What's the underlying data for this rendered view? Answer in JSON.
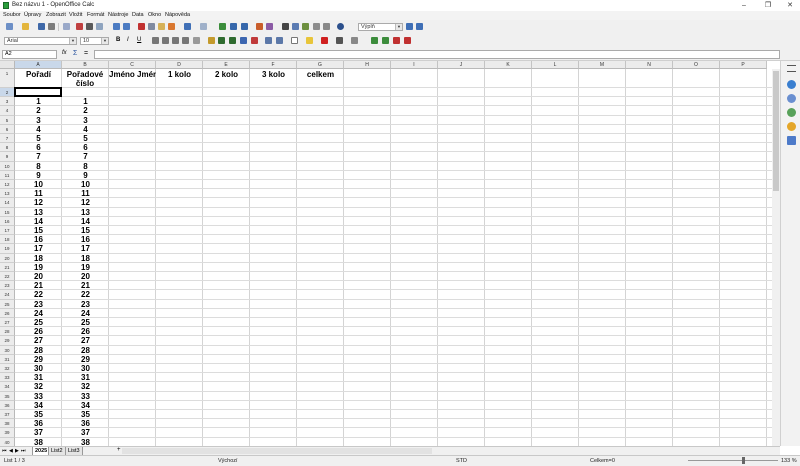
{
  "window": {
    "title": "Bez názvu 1 - OpenOffice Calc",
    "minimize": "–",
    "maximize": "❐",
    "close": "✕"
  },
  "menu": [
    "Soubor",
    "Úpravy",
    "Zobrazit",
    "Vložit",
    "Formát",
    "Nástroje",
    "Data",
    "Okno",
    "Nápověda"
  ],
  "toolbar": {
    "style_value": "Výplň"
  },
  "format_bar": {
    "font_name": "Arial",
    "font_size": "10",
    "bold": "B",
    "italic": "I",
    "underline": "U"
  },
  "formula_bar": {
    "cell_ref": "A2",
    "function_icon": "fx",
    "sum_icon": "Σ",
    "equals": "=",
    "formula": ""
  },
  "columns": [
    "A",
    "B",
    "C",
    "D",
    "E",
    "F",
    "G",
    "H",
    "I",
    "J",
    "K",
    "L",
    "M",
    "N",
    "O",
    "P"
  ],
  "header_row": [
    "Pořadí",
    "Pořadové číslo",
    "Jméno Jméno",
    "1 kolo",
    "2 kolo",
    "3 kolo",
    "celkem"
  ],
  "row_numbers": [
    "1",
    "2",
    "3",
    "4",
    "5",
    "6",
    "7",
    "8",
    "9",
    "10",
    "11",
    "12",
    "13",
    "14",
    "15",
    "16",
    "17",
    "18",
    "19",
    "20",
    "21",
    "22",
    "23",
    "24",
    "25",
    "26",
    "27",
    "28",
    "29",
    "30",
    "31",
    "32",
    "33",
    "34",
    "35",
    "36",
    "37",
    "38",
    "39",
    "40"
  ],
  "data_rows": [
    "1",
    "2",
    "3",
    "4",
    "5",
    "6",
    "7",
    "8",
    "9",
    "10",
    "11",
    "12",
    "13",
    "14",
    "15",
    "16",
    "17",
    "18",
    "19",
    "20",
    "21",
    "22",
    "23",
    "24",
    "25",
    "26",
    "27",
    "28",
    "29",
    "30",
    "31",
    "32",
    "33",
    "34",
    "35",
    "36",
    "37",
    "38"
  ],
  "sheets": {
    "tabs": [
      "2025",
      "List2",
      "List3"
    ],
    "add": "+"
  },
  "status": {
    "sheet": "List 1 / 3",
    "page_style": "Výchozí",
    "mode": "STD",
    "sum": "Celkem=0",
    "zoom": "133 %"
  },
  "colors": {
    "selection": "#c9d8ea",
    "header_bg": "#ececec",
    "grid": "#dcdcdc"
  }
}
